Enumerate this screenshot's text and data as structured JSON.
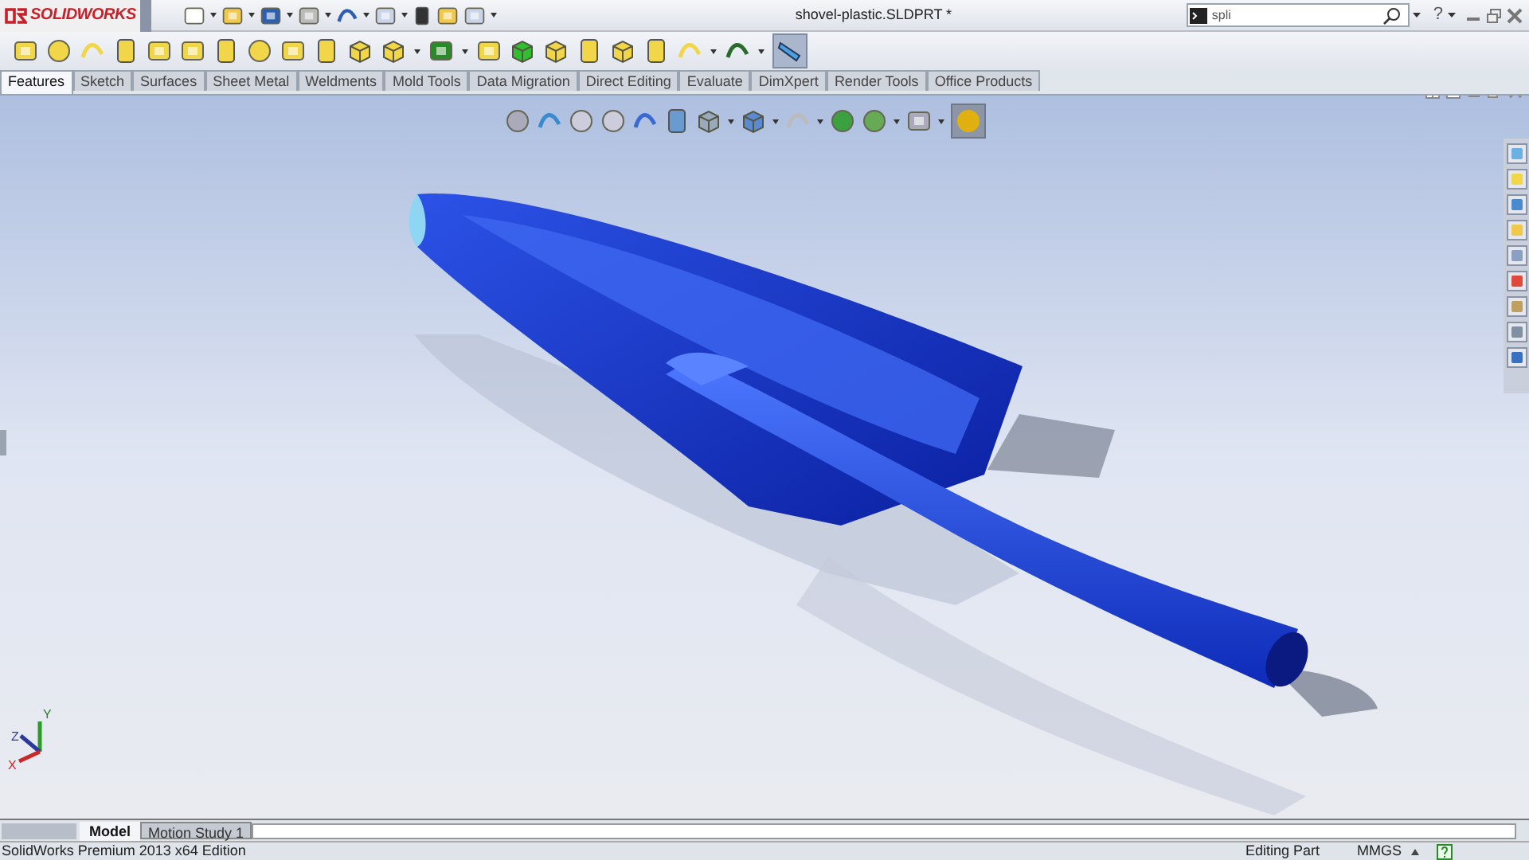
{
  "app": {
    "logo": "SOLIDWORKS"
  },
  "window": {
    "title": "shovel-plastic.SLDPRT *"
  },
  "search": {
    "value": "spli"
  },
  "help": "?",
  "command_tabs": [
    {
      "label": "Features",
      "selected": true
    },
    {
      "label": "Sketch",
      "selected": false
    },
    {
      "label": "Surfaces",
      "selected": false
    },
    {
      "label": "Sheet Metal",
      "selected": false
    },
    {
      "label": "Weldments",
      "selected": false
    },
    {
      "label": "Mold Tools",
      "selected": false
    },
    {
      "label": "Data Migration",
      "selected": false
    },
    {
      "label": "Direct Editing",
      "selected": false
    },
    {
      "label": "Evaluate",
      "selected": false
    },
    {
      "label": "DimXpert",
      "selected": false
    },
    {
      "label": "Render Tools",
      "selected": false
    },
    {
      "label": "Office Products",
      "selected": false
    }
  ],
  "triad": {
    "y": "Y",
    "z": "Z",
    "x": "X"
  },
  "bottom_tabs": [
    {
      "label": "Model",
      "selected": true
    },
    {
      "label": "Motion Study 1",
      "selected": false
    }
  ],
  "status_bar": {
    "edition": "SolidWorks Premium 2013 x64 Edition",
    "mode": "Editing Part",
    "units": "MMGS"
  }
}
